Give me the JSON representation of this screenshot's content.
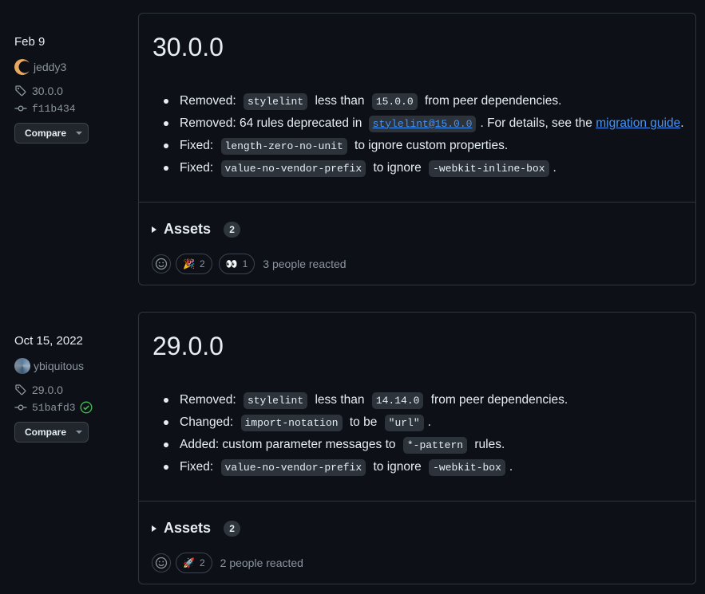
{
  "releases": [
    {
      "date": "Feb 9",
      "author": "jeddy3",
      "tag": "30.0.0",
      "commit": "f11b434",
      "compare_label": "Compare",
      "version": "30.0.0",
      "notes": [
        {
          "parts": [
            {
              "t": "text",
              "v": "Removed: "
            },
            {
              "t": "code",
              "v": "stylelint"
            },
            {
              "t": "text",
              "v": " less than "
            },
            {
              "t": "code",
              "v": "15.0.0"
            },
            {
              "t": "text",
              "v": " from peer dependencies."
            }
          ]
        },
        {
          "parts": [
            {
              "t": "text",
              "v": "Removed: 64 rules deprecated in "
            },
            {
              "t": "codelink",
              "v": "stylelint@15.0.0"
            },
            {
              "t": "text",
              "v": ". For details, see the "
            },
            {
              "t": "link",
              "v": "migration guide"
            },
            {
              "t": "text",
              "v": "."
            }
          ]
        },
        {
          "parts": [
            {
              "t": "text",
              "v": "Fixed: "
            },
            {
              "t": "code",
              "v": "length-zero-no-unit"
            },
            {
              "t": "text",
              "v": " to ignore custom properties."
            }
          ]
        },
        {
          "parts": [
            {
              "t": "text",
              "v": "Fixed: "
            },
            {
              "t": "code",
              "v": "value-no-vendor-prefix"
            },
            {
              "t": "text",
              "v": " to ignore "
            },
            {
              "t": "code",
              "v": "-webkit-inline-box"
            },
            {
              "t": "text",
              "v": "."
            }
          ]
        }
      ],
      "assets_label": "Assets",
      "assets_count": "2",
      "reactions": [
        {
          "emoji": "🎉",
          "name": "tada",
          "count": "2"
        },
        {
          "emoji": "👀",
          "name": "eyes",
          "count": "1"
        }
      ],
      "reactions_summary": "3 people reacted"
    },
    {
      "date": "Oct 15, 2022",
      "author": "ybiquitous",
      "tag": "29.0.0",
      "commit": "51bafd3",
      "verified": true,
      "compare_label": "Compare",
      "version": "29.0.0",
      "notes": [
        {
          "parts": [
            {
              "t": "text",
              "v": "Removed: "
            },
            {
              "t": "code",
              "v": "stylelint"
            },
            {
              "t": "text",
              "v": " less than "
            },
            {
              "t": "code",
              "v": "14.14.0"
            },
            {
              "t": "text",
              "v": " from peer dependencies."
            }
          ]
        },
        {
          "parts": [
            {
              "t": "text",
              "v": "Changed: "
            },
            {
              "t": "code",
              "v": "import-notation"
            },
            {
              "t": "text",
              "v": " to be "
            },
            {
              "t": "code",
              "v": "\"url\""
            },
            {
              "t": "text",
              "v": "."
            }
          ]
        },
        {
          "parts": [
            {
              "t": "text",
              "v": "Added: custom parameter messages to "
            },
            {
              "t": "code",
              "v": "*-pattern"
            },
            {
              "t": "text",
              "v": " rules."
            }
          ]
        },
        {
          "parts": [
            {
              "t": "text",
              "v": "Fixed: "
            },
            {
              "t": "code",
              "v": "value-no-vendor-prefix"
            },
            {
              "t": "text",
              "v": " to ignore "
            },
            {
              "t": "code",
              "v": "-webkit-box"
            },
            {
              "t": "text",
              "v": "."
            }
          ]
        }
      ],
      "assets_label": "Assets",
      "assets_count": "2",
      "reactions": [
        {
          "emoji": "🚀",
          "name": "rocket",
          "count": "2"
        }
      ],
      "reactions_summary": "2 people reacted"
    }
  ],
  "icons": {
    "tag": "tag-icon",
    "commit": "git-commit-icon",
    "verified": "check-circle-icon",
    "add_reaction": "smiley-icon"
  },
  "colors": {
    "background": "#0d1117",
    "border": "#30363d",
    "link": "#4493f8",
    "muted": "#8b949e",
    "verified": "#3fb950"
  }
}
